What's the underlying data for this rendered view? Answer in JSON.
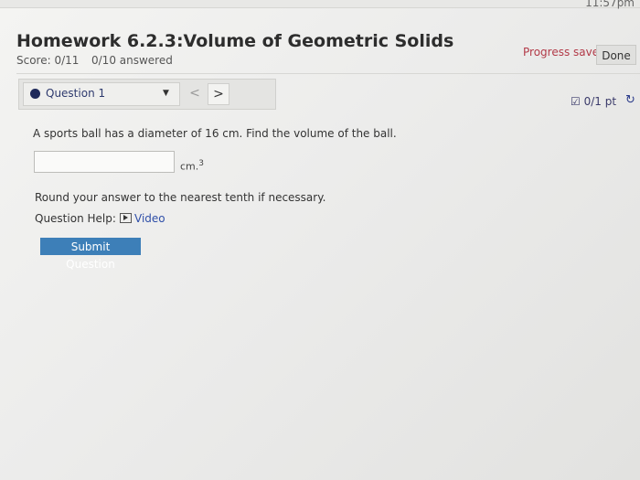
{
  "status": {
    "clock": "11:57pm"
  },
  "assignment": {
    "title": "Homework 6.2.3:Volume of Geometric Solids",
    "score": "Score: 0/11",
    "answered": "0/10 answered",
    "progress": "Progress saved",
    "done_label": "Done"
  },
  "nav": {
    "question_label": "Question 1",
    "prev": "<",
    "next": ">",
    "points": "0/1 pt"
  },
  "question": {
    "text": "A sports ball has a diameter of 16 cm. Find the volume of the ball.",
    "answer_value": "",
    "unit": "cm.",
    "unit_exp": "3",
    "round_note": "Round your answer to the nearest tenth if necessary.",
    "help_label": "Question Help:",
    "video_label": "Video",
    "submit_label": "Submit Question"
  },
  "colors": {
    "accent": "#3d7fb8",
    "progress": "#b23a48",
    "link": "#2f4fa8"
  }
}
